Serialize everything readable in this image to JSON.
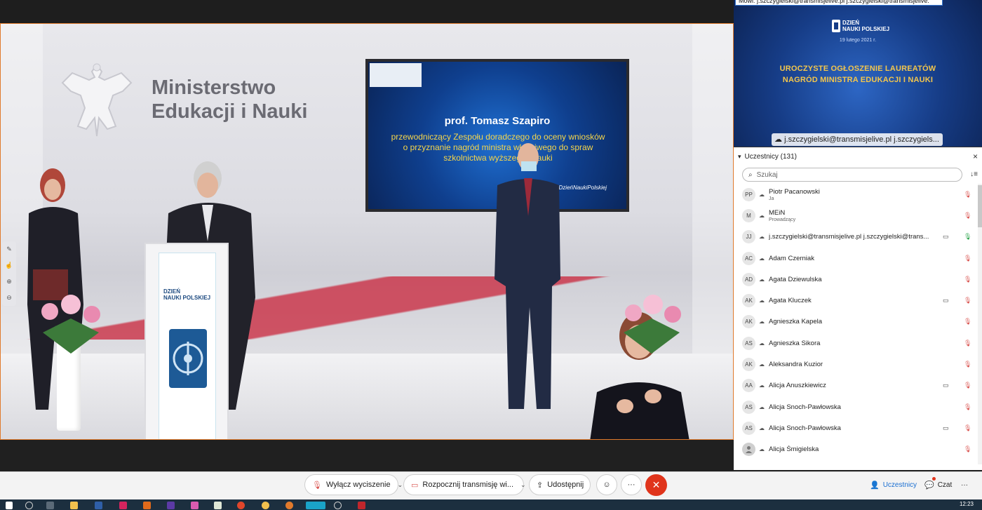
{
  "stage": {
    "ministry_line1": "Ministerstwo",
    "ministry_line2": "Edukacji i Nauki",
    "screen_name": "prof. Tomasz Szapiro",
    "screen_role": "przewodniczący Zespołu doradczego do oceny wniosków o przyznanie nagród ministra właściwego do spraw szkolnictwa wyższego i nauki",
    "screen_tag": "#DzieńNaukiPolskiej",
    "podium_logo_line1": "DZIEŃ",
    "podium_logo_line2": "NAUKI POLSKIEJ"
  },
  "side_video": {
    "speaker_tip": "Mówi: j.szczygielski@transmisjelive.pl j.szczygielski@transmisjelive.",
    "logo_line1": "DZIEŃ",
    "logo_line2": "NAUKI POLSKIEJ",
    "date": "19 lutego 2021 r.",
    "headline": "UROCZYSTE OGŁOSZENIE LAUREATÓW NAGRÓD MINISTRA EDUKACJI I NAUKI",
    "name_chip": "j.szczygielski@transmisjelive.pl j.szczygiels..."
  },
  "participants": {
    "title": "Uczestnicy (131)",
    "search_placeholder": "Szukaj",
    "list": [
      {
        "initials": "PP",
        "name": "Piotr Pacanowski",
        "role": "Ja",
        "cam": "",
        "mic": "off"
      },
      {
        "initials": "M",
        "name": "MEiN",
        "role": "Prowadzący",
        "cam": "",
        "mic": "off"
      },
      {
        "initials": "JJ",
        "name": "j.szczygielski@transmisjelive.pl j.szczygielski@trans...",
        "role": "",
        "cam": "video",
        "mic": "on"
      },
      {
        "initials": "AC",
        "name": "Adam Czerniak",
        "role": "",
        "cam": "",
        "mic": "off"
      },
      {
        "initials": "AD",
        "name": "Agata Dziewulska",
        "role": "",
        "cam": "",
        "mic": "off"
      },
      {
        "initials": "AK",
        "name": "Agata Kluczek",
        "role": "",
        "cam": "video",
        "mic": "off"
      },
      {
        "initials": "AK",
        "name": "Agnieszka Kapela",
        "role": "",
        "cam": "",
        "mic": "off"
      },
      {
        "initials": "AS",
        "name": "Agnieszka Sikora",
        "role": "",
        "cam": "",
        "mic": "off"
      },
      {
        "initials": "AK",
        "name": "Aleksandra Kuzior",
        "role": "",
        "cam": "",
        "mic": "off"
      },
      {
        "initials": "AA",
        "name": "Alicja Anuszkiewicz",
        "role": "",
        "cam": "video",
        "mic": "off"
      },
      {
        "initials": "AS",
        "name": "Alicja Snoch-Pawłowska",
        "role": "",
        "cam": "",
        "mic": "off"
      },
      {
        "initials": "AS",
        "name": "Alicja Snoch-Pawłowska",
        "role": "",
        "cam": "video",
        "mic": "off"
      },
      {
        "initials": "",
        "name": "Alicja Śmigielska",
        "role": "",
        "cam": "",
        "mic": "off"
      }
    ]
  },
  "controls": {
    "mute_label": "Wyłącz wyciszenie",
    "stream_label": "Rozpocznij transmisję wi...",
    "share_label": "Udostępnij",
    "participants_tab": "Uczestnicy",
    "chat_tab": "Czat"
  },
  "taskbar": {
    "clock": "12:23"
  },
  "colors": {
    "stage_border": "#e07a2c",
    "end_call": "#e0341b",
    "accent_blue": "#1a6fd1",
    "mic_muted": "#d9534f",
    "mic_active": "#2aa34a"
  }
}
